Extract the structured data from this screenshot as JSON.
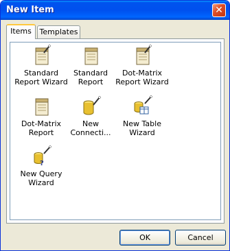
{
  "dialog": {
    "title": "New Item",
    "close_glyph": "✕"
  },
  "tabs": [
    {
      "label": "Items",
      "active": true
    },
    {
      "label": "Templates",
      "active": false
    }
  ],
  "items": [
    {
      "label": "Standard Report Wizard",
      "line1": "Standard",
      "line2": "Report Wizard",
      "icon": "report-wizard-icon"
    },
    {
      "label": "Standard Report",
      "line1": "Standard",
      "line2": "Report",
      "icon": "report-icon"
    },
    {
      "label": "Dot-Matrix Report Wizard",
      "line1": "Dot-Matrix",
      "line2": "Report Wizard",
      "icon": "report-wizard-icon"
    },
    {
      "label": "Dot-Matrix Report",
      "line1": "Dot-Matrix",
      "line2": "Report",
      "icon": "report-icon"
    },
    {
      "label": "New Connection",
      "line1": "New",
      "line2": "Connecti...",
      "icon": "database-connection-icon"
    },
    {
      "label": "New Table Wizard",
      "line1": "New Table",
      "line2": "Wizard",
      "icon": "table-wizard-icon"
    },
    {
      "label": "New Query Wizard",
      "line1": "New Query",
      "line2": "Wizard",
      "icon": "query-wizard-icon"
    }
  ],
  "buttons": {
    "ok": "OK",
    "cancel": "Cancel"
  }
}
